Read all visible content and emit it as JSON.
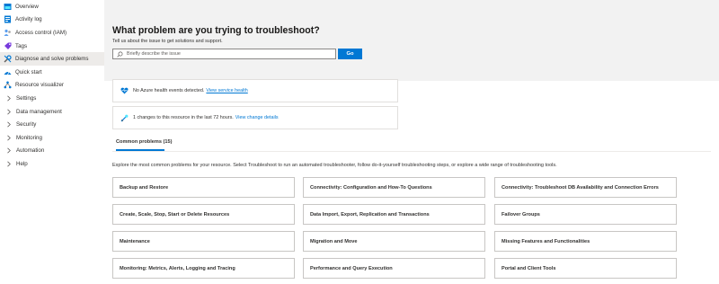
{
  "sidebar": {
    "items": [
      {
        "label": "Overview",
        "icon": "overview-icon",
        "type": "icon"
      },
      {
        "label": "Activity log",
        "icon": "activity-log-icon",
        "type": "icon"
      },
      {
        "label": "Access control (IAM)",
        "icon": "iam-icon",
        "type": "icon"
      },
      {
        "label": "Tags",
        "icon": "tag-icon",
        "type": "icon"
      },
      {
        "label": "Diagnose and solve problems",
        "icon": "wrench-icon",
        "type": "icon",
        "active": true
      },
      {
        "label": "Quick start",
        "icon": "quick-start-icon",
        "type": "icon"
      },
      {
        "label": "Resource visualizer",
        "icon": "visualizer-icon",
        "type": "icon"
      },
      {
        "label": "Settings",
        "icon": "chevron-right-icon",
        "type": "group"
      },
      {
        "label": "Data management",
        "icon": "chevron-right-icon",
        "type": "group"
      },
      {
        "label": "Security",
        "icon": "chevron-right-icon",
        "type": "group"
      },
      {
        "label": "Monitoring",
        "icon": "chevron-right-icon",
        "type": "group"
      },
      {
        "label": "Automation",
        "icon": "chevron-right-icon",
        "type": "group"
      },
      {
        "label": "Help",
        "icon": "chevron-right-icon",
        "type": "group"
      }
    ]
  },
  "hero": {
    "title": "What problem are you trying to troubleshoot?",
    "subtitle": "Tell us about the issue to get solutions and support.",
    "search_placeholder": "Briefly describe the issue",
    "go_label": "Go"
  },
  "health": {
    "text": "No Azure health events detected.",
    "link": "View service health"
  },
  "changes": {
    "text": "1 changes to this resource in the last 72 hours.",
    "link": "View change details"
  },
  "tab": {
    "label": "Common problems (15)"
  },
  "explore_text": "Explore the most common problems for your resource. Select Troubleshoot to run an automated troubleshooter, follow do-it-yourself troubleshooting steps, or explore a wide range of troubleshooting tools.",
  "problems": [
    "Backup and Restore",
    "Connectivity: Configuration and How-To Questions",
    "Connectivity: Troubleshoot DB Availability and Connection Errors",
    "Create, Scale, Stop, Start or Delete Resources",
    "Data Import, Export, Replication and Transactions",
    "Failover Groups",
    "Maintenance",
    "Migration and Move",
    "Missing Features and Functionalities",
    "Monitoring: Metrics, Alerts, Logging and Tracing",
    "Performance and Query Execution",
    "Portal and Client Tools"
  ],
  "colors": {
    "accent": "#0078d4",
    "hero_bg": "#f2f2f2",
    "active_nav_bg": "#edebe9"
  }
}
